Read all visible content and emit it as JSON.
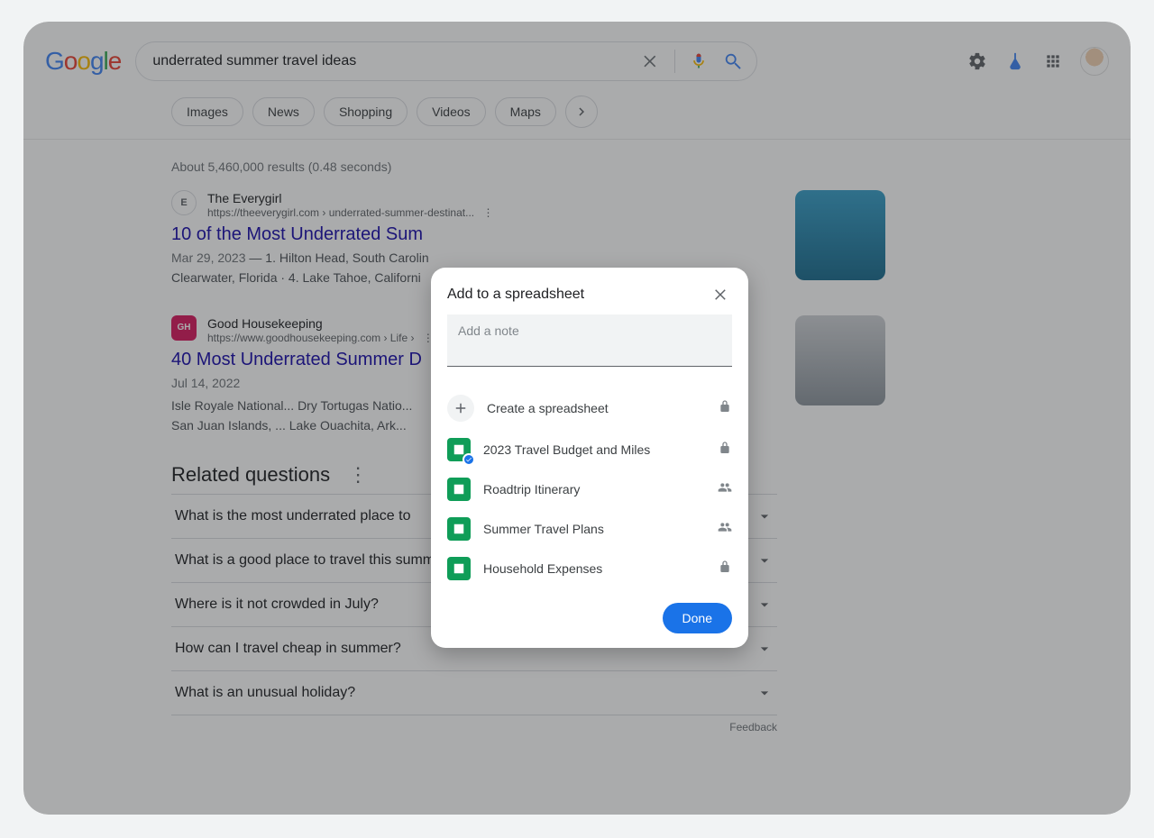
{
  "query": "underrated summer travel ideas",
  "tabs": [
    "Images",
    "News",
    "Shopping",
    "Videos",
    "Maps"
  ],
  "stats": "About 5,460,000 results (0.48 seconds)",
  "results": [
    {
      "site": "The Everygirl",
      "url_display": "https://theeverygirl.com › underrated-summer-destinat...",
      "title": "10 of the Most Underrated Sum",
      "date": "Mar 29, 2023",
      "snippet_a": "1. Hilton Head, South Carolin",
      "snippet_b": "Clearwater, Florida · 4. Lake Tahoe, Californi"
    },
    {
      "site": "Good Housekeeping",
      "url_display": "https://www.goodhousekeeping.com › Life ›",
      "title": "40 Most Underrated Summer D",
      "date": "Jul 14, 2022",
      "snippet_a": "Isle Royale National... Dry Tortugas Natio...",
      "snippet_b": "San Juan Islands, ...   Lake Ouachita, Ark..."
    }
  ],
  "related_title": "Related questions",
  "related": [
    "What is the most underrated place to",
    "What is a good place to travel this summer?",
    "Where is it not crowded in July?",
    "How can I travel cheap in summer?",
    "What is an unusual holiday?"
  ],
  "feedback": "Feedback",
  "modal": {
    "title": "Add to a spreadsheet",
    "note_placeholder": "Add a note",
    "create_label": "Create a spreadsheet",
    "items": [
      {
        "label": "2023 Travel Budget and Miles",
        "trailing": "lock",
        "checked": true
      },
      {
        "label": "Roadtrip Itinerary",
        "trailing": "shared",
        "checked": false
      },
      {
        "label": "Summer Travel Plans",
        "trailing": "shared",
        "checked": false
      },
      {
        "label": "Household Expenses",
        "trailing": "lock",
        "checked": false
      }
    ],
    "done": "Done"
  },
  "logo": {
    "g1": "G",
    "g2": "o",
    "g3": "o",
    "g4": "g",
    "g5": "l",
    "g6": "e"
  }
}
